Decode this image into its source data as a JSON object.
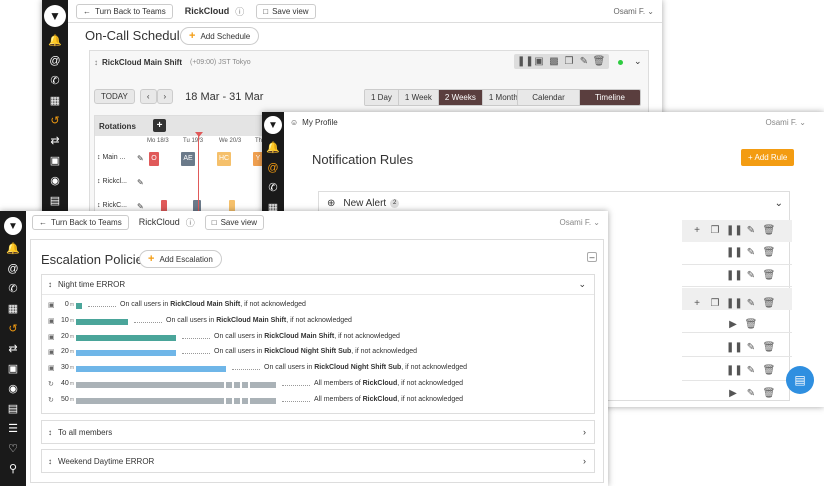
{
  "colors": {
    "accent": "#f39c12",
    "rail": "#1a1a1a",
    "teal": "#4aa59a",
    "blue": "#6fb6e8",
    "grey": "#aab2b7",
    "dark_tab": "#5a3e3e"
  },
  "win1": {
    "back_label": "Turn Back to Teams",
    "team": "RickCloud",
    "save_view": "Save view",
    "user": "Osami F.",
    "title": "On-Call Schedules",
    "add_schedule": "Add Schedule",
    "schedule_name": "RickCloud Main Shift",
    "timezone": "(+09:00) JST Tokyo",
    "today": "TODAY",
    "range": "18 Mar - 31 Mar",
    "periods": [
      "1 Day",
      "1 Week",
      "2 Weeks",
      "1 Month"
    ],
    "views": [
      "Calendar",
      "Timeline"
    ],
    "rotations_label": "Rotations",
    "days": [
      "Mo 18/3",
      "Tu 19/3",
      "We 20/3",
      "Th"
    ],
    "rotations": [
      "Main ...",
      "Rickcl...",
      "RickC..."
    ],
    "badges": [
      "O",
      "AE",
      "HC",
      "Y"
    ]
  },
  "win2": {
    "title_bar": "My Profile",
    "user": "Osami F.",
    "title": "Notification Rules",
    "add_rule": "Add Rule",
    "new_alert": "New Alert",
    "new_alert_count": "2"
  },
  "win3": {
    "back_label": "Turn Back to Teams",
    "team": "RickCloud",
    "save_view": "Save view",
    "user": "Osami F.",
    "title": "Escalation Policies",
    "add_escalation": "Add Escalation",
    "policy_name": "Night time ERROR",
    "steps": [
      {
        "time": "0",
        "unit": "m",
        "pre": "On call users in ",
        "bold": "RickCloud Main Shift",
        "post": ", if not acknowledged",
        "color": "teal",
        "fill": 0.03
      },
      {
        "time": "10",
        "unit": "m",
        "pre": "On call users in ",
        "bold": "RickCloud Main Shift",
        "post": ", if not acknowledged",
        "color": "teal",
        "fill": 0.26
      },
      {
        "time": "20",
        "unit": "m",
        "pre": "On call users in ",
        "bold": "RickCloud Main Shift",
        "post": ", if not acknowledged",
        "color": "teal",
        "fill": 0.5
      },
      {
        "time": "20",
        "unit": "m",
        "pre": "On call users in ",
        "bold": "RickCloud Night Shift Sub",
        "post": ", if not acknowledged",
        "color": "blue",
        "fill": 0.5
      },
      {
        "time": "30",
        "unit": "m",
        "pre": "On call users in ",
        "bold": "RickCloud Night Shift Sub",
        "post": ", if not acknowledged",
        "color": "blue",
        "fill": 0.75
      },
      {
        "time": "40",
        "unit": "m",
        "pre": "All members of ",
        "bold": "RickCloud",
        "post": ", if not acknowledged",
        "color": "grey",
        "fill": 1.0
      },
      {
        "time": "50",
        "unit": "m",
        "pre": "All members of ",
        "bold": "RickCloud",
        "post": ", if not acknowledged",
        "color": "grey",
        "fill": 1.0
      }
    ],
    "collapsed": [
      "To all members",
      "Weekend Daytime ERROR"
    ]
  }
}
